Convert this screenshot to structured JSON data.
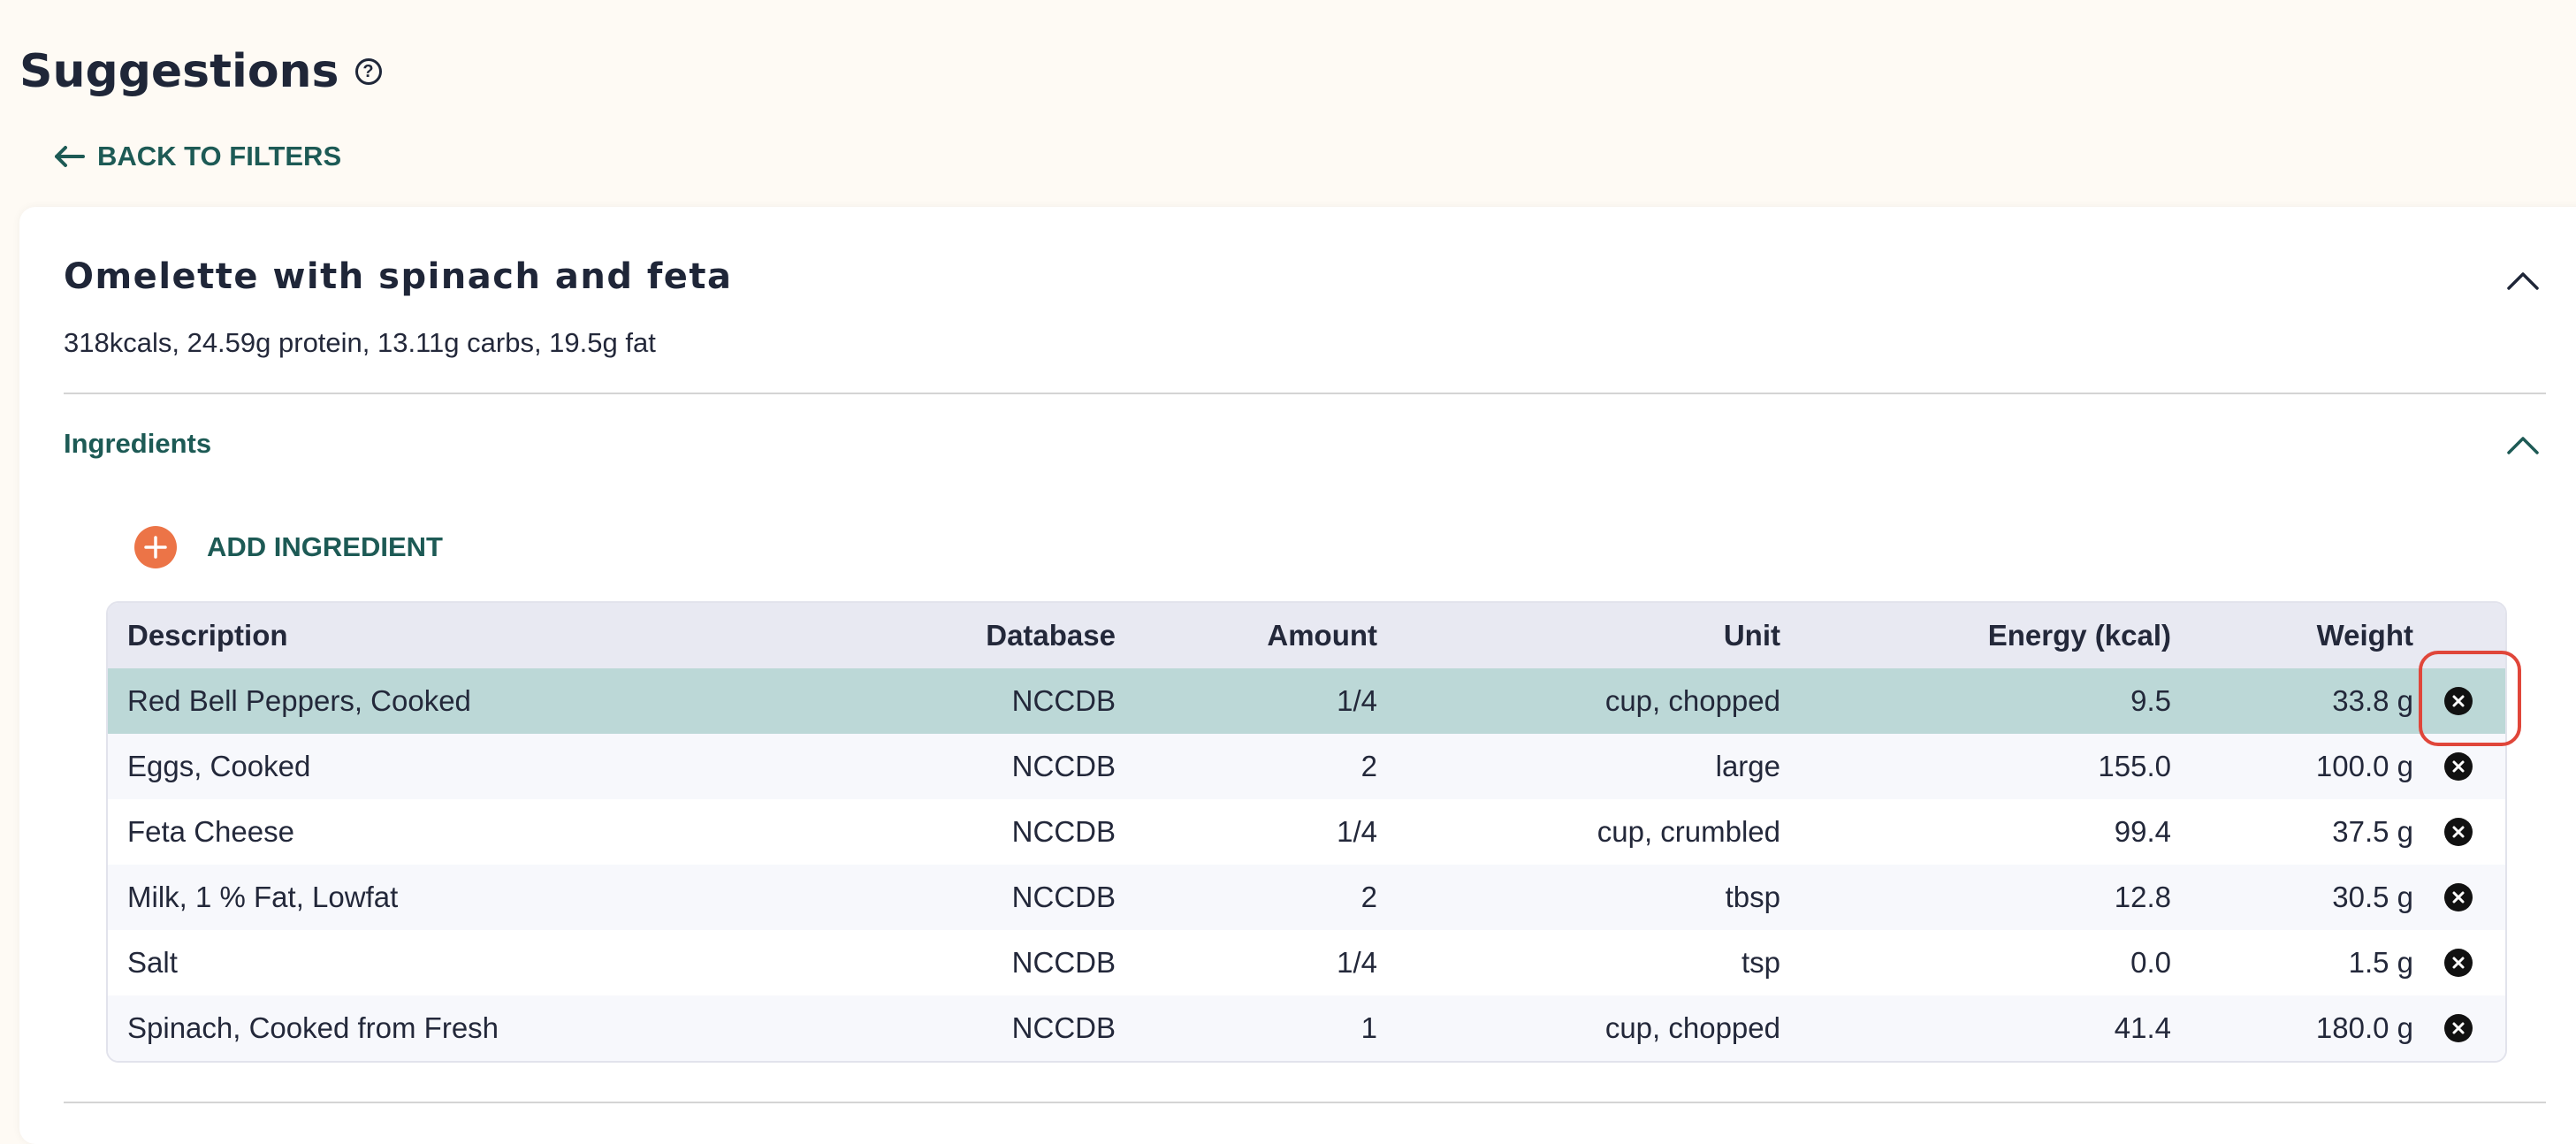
{
  "page": {
    "title": "Suggestions",
    "help_icon": "question-circle-icon",
    "back_label": "BACK TO FILTERS"
  },
  "recipe": {
    "title": "Omelette with spinach and feta",
    "summary": "318kcals, 24.59g protein, 13.11g carbs, 19.5g fat",
    "ingredients_label": "Ingredients",
    "add_ingredient_label": "ADD INGREDIENT"
  },
  "table": {
    "columns": [
      "Description",
      "Database",
      "Amount",
      "Unit",
      "Energy (kcal)",
      "Weight"
    ],
    "rows": [
      {
        "description": "Red Bell Peppers, Cooked",
        "database": "NCCDB",
        "amount": "1/4",
        "unit": "cup, chopped",
        "energy": "9.5",
        "weight": "33.8 g",
        "selected": true
      },
      {
        "description": "Eggs, Cooked",
        "database": "NCCDB",
        "amount": "2",
        "unit": "large",
        "energy": "155.0",
        "weight": "100.0 g",
        "selected": false
      },
      {
        "description": "Feta Cheese",
        "database": "NCCDB",
        "amount": "1/4",
        "unit": "cup, crumbled",
        "energy": "99.4",
        "weight": "37.5 g",
        "selected": false
      },
      {
        "description": "Milk, 1 % Fat, Lowfat",
        "database": "NCCDB",
        "amount": "2",
        "unit": "tbsp",
        "energy": "12.8",
        "weight": "30.5 g",
        "selected": false
      },
      {
        "description": "Salt",
        "database": "NCCDB",
        "amount": "1/4",
        "unit": "tsp",
        "energy": "0.0",
        "weight": "1.5 g",
        "selected": false
      },
      {
        "description": "Spinach, Cooked from Fresh",
        "database": "NCCDB",
        "amount": "1",
        "unit": "cup, chopped",
        "energy": "41.4",
        "weight": "180.0 g",
        "selected": false
      }
    ]
  },
  "colors": {
    "background": "#fefaf4",
    "accent_teal": "#1d5a55",
    "selected_row": "#bcd8d7",
    "alt_row": "#f7f8fc",
    "add_button": "#ec7447",
    "highlight": "#e0463a"
  }
}
